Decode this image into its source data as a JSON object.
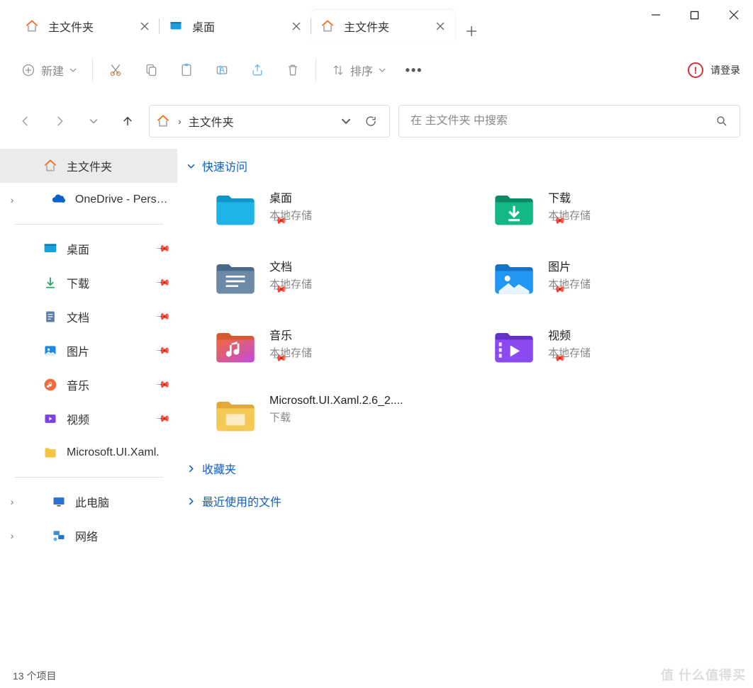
{
  "tabs": [
    {
      "label": "主文件夹",
      "icon": "home",
      "active": false
    },
    {
      "label": "桌面",
      "icon": "desktop",
      "active": false
    },
    {
      "label": "主文件夹",
      "icon": "home",
      "active": true
    }
  ],
  "toolbar": {
    "new": "新建",
    "sort": "排序",
    "login": "请登录"
  },
  "breadcrumb": {
    "label": "主文件夹"
  },
  "search": {
    "placeholder": "在 主文件夹 中搜索"
  },
  "sidebar": {
    "top": [
      {
        "label": "主文件夹",
        "icon": "home",
        "sel": true,
        "chev": false
      },
      {
        "label": "OneDrive - Person",
        "icon": "onedrive",
        "sel": false,
        "chev": true
      }
    ],
    "quick": [
      {
        "label": "桌面",
        "icon": "desktop",
        "pin": true
      },
      {
        "label": "下载",
        "icon": "download",
        "pin": true
      },
      {
        "label": "文档",
        "icon": "documents",
        "pin": true
      },
      {
        "label": "图片",
        "icon": "pictures",
        "pin": true
      },
      {
        "label": "音乐",
        "icon": "music",
        "pin": true
      },
      {
        "label": "视频",
        "icon": "video",
        "pin": true
      },
      {
        "label": "Microsoft.UI.Xaml.",
        "icon": "folder",
        "pin": false
      }
    ],
    "bottom": [
      {
        "label": "此电脑",
        "icon": "pc"
      },
      {
        "label": "网络",
        "icon": "network"
      }
    ]
  },
  "sections": {
    "quick": "快速访问",
    "fav": "收藏夹",
    "recent": "最近使用的文件"
  },
  "tiles": [
    {
      "name": "桌面",
      "sub": "本地存储",
      "icon": "desktop-folder",
      "pin": true
    },
    {
      "name": "下载",
      "sub": "本地存储",
      "icon": "downloads-folder",
      "pin": true
    },
    {
      "name": "文档",
      "sub": "本地存储",
      "icon": "documents-folder",
      "pin": true
    },
    {
      "name": "图片",
      "sub": "本地存储",
      "icon": "pictures-folder",
      "pin": true
    },
    {
      "name": "音乐",
      "sub": "本地存储",
      "icon": "music-folder",
      "pin": true
    },
    {
      "name": "视频",
      "sub": "本地存储",
      "icon": "video-folder",
      "pin": true
    },
    {
      "name": "Microsoft.UI.Xaml.2.6_2....",
      "sub": "下载",
      "icon": "folder",
      "pin": false
    }
  ],
  "status": "13 个项目",
  "watermark": "值 什么值得买"
}
